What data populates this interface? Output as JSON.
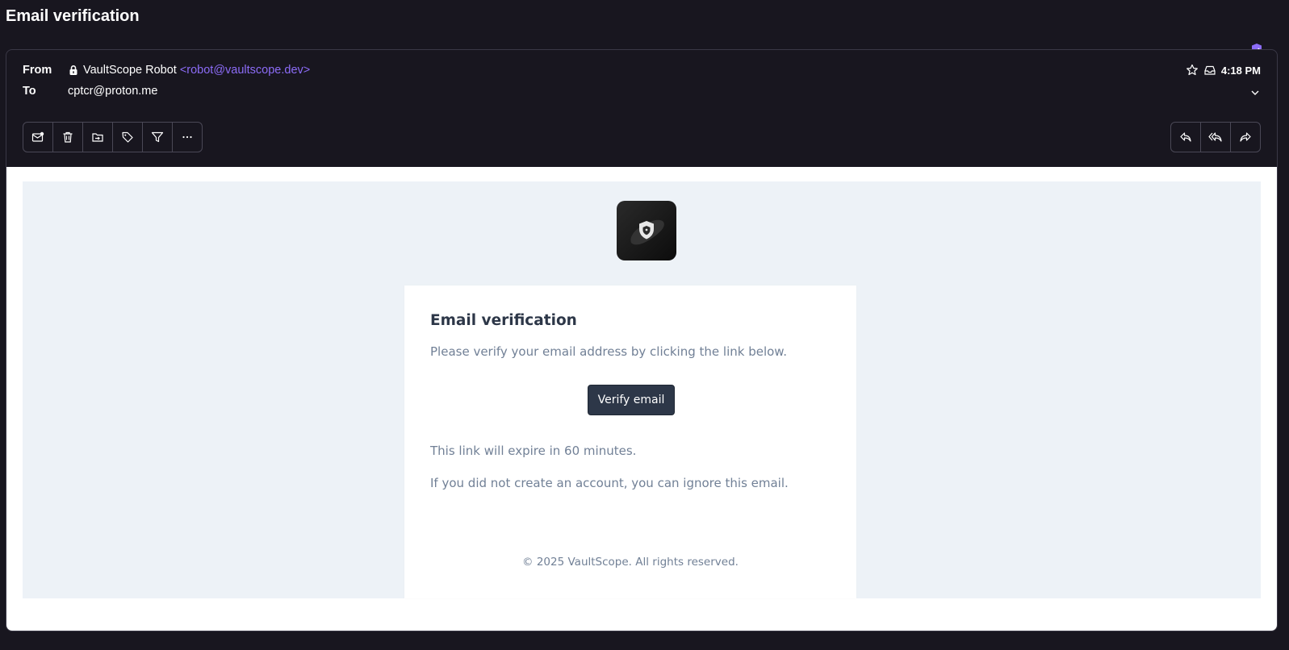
{
  "page": {
    "title": "Email verification"
  },
  "header": {
    "from_label": "From",
    "to_label": "To",
    "sender_name": "VaultScope Robot",
    "sender_address": "<robot@vaultscope.dev>",
    "recipient": "cptcr@proton.me",
    "time": "4:18 PM"
  },
  "toolbar": {
    "left_icons": [
      "mark-unread-icon",
      "trash-icon",
      "move-to-folder-icon",
      "label-tag-icon",
      "filter-icon",
      "more-icon"
    ],
    "right_icons": [
      "reply-icon",
      "reply-all-icon",
      "forward-icon"
    ]
  },
  "email": {
    "heading": "Email verification",
    "intro": "Please verify your email address by clicking the link below.",
    "button_label": "Verify email",
    "expire_note": "This link will expire in 60 minutes.",
    "ignore_note": "If you did not create an account, you can ignore this email.",
    "footer": "© 2025 VaultScope. All rights reserved."
  },
  "colors": {
    "accent": "#8c6cf7",
    "background": "#18161f",
    "button": "#2d3748"
  }
}
